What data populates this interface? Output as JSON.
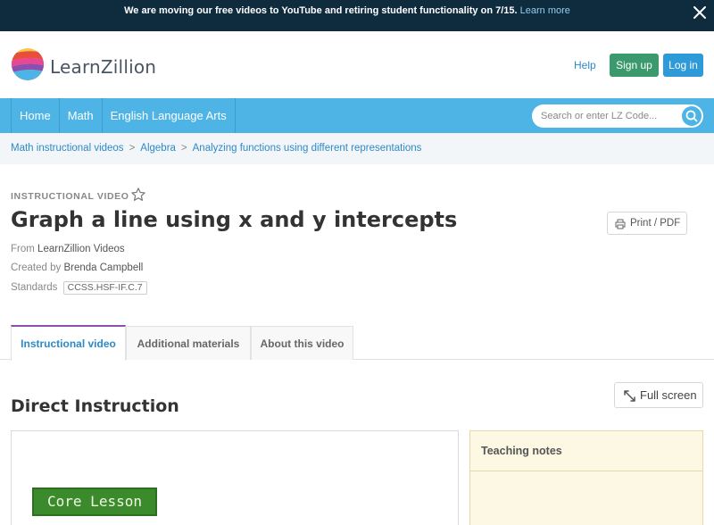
{
  "banner": {
    "message": "We are moving our free videos to YouTube and retiring student functionality on 7/15.",
    "link": "Learn more",
    "close_icon": "close-icon"
  },
  "header": {
    "brand": "LearnZillion",
    "help": "Help",
    "signup": "Sign up",
    "login": "Log in"
  },
  "nav": {
    "items": [
      "Home",
      "Math",
      "English Language Arts"
    ],
    "search_placeholder": "Search or enter LZ Code...",
    "search_icon": "search-icon"
  },
  "breadcrumbs": {
    "items": [
      "Math instructional videos",
      "Algebra",
      "Analyzing functions using different representations"
    ],
    "separator": ">"
  },
  "lesson": {
    "kind": "INSTRUCTIONAL VIDEO",
    "title": "Graph a line using x and y intercepts",
    "print": "Print / PDF",
    "from_label": "From",
    "from_value": "LearnZillion Videos",
    "created_label": "Created by",
    "created_value": "Brenda Campbell",
    "standards_label": "Standards",
    "standard": "CCSS.HSF-IF.C.7"
  },
  "tabs": [
    "Instructional video",
    "Additional materials",
    "About this video"
  ],
  "content": {
    "section_title": "Direct Instruction",
    "fullscreen": "Full screen",
    "video_badge": "Core Lesson",
    "notes_title": "Teaching notes"
  },
  "colors": {
    "banner_bg": "#0f2b3e",
    "nav_bg": "#4eb4e6",
    "link": "#2c8ac8",
    "signup_bg": "#3a9a6e",
    "login_bg": "#2e9ad8",
    "tab_accent": "#8b4fb0",
    "notes_bg": "#fcf8e3"
  }
}
